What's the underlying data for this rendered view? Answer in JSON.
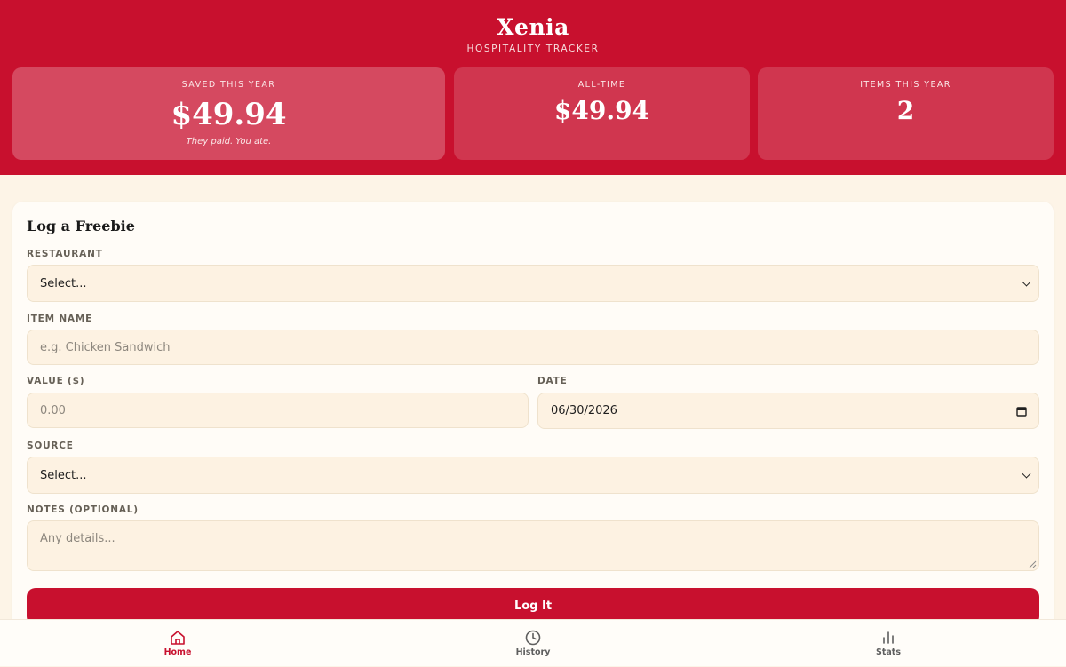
{
  "brand": {
    "title": "Xenia",
    "subtitle": "HOSPITALITY TRACKER"
  },
  "stats": {
    "saved_year": {
      "label": "SAVED THIS YEAR",
      "value": "$49.94",
      "note": "They paid. You ate."
    },
    "all_time": {
      "label": "ALL-TIME",
      "value": "$49.94"
    },
    "items_year": {
      "label": "ITEMS THIS YEAR",
      "value": "2"
    }
  },
  "form": {
    "title": "Log a Freebie",
    "restaurant": {
      "label": "RESTAURANT",
      "value": "Select..."
    },
    "item_name": {
      "label": "ITEM NAME",
      "placeholder": "e.g. Chicken Sandwich"
    },
    "value": {
      "label": "VALUE ($)",
      "placeholder": "0.00"
    },
    "date": {
      "label": "DATE",
      "value": "06/30/2026"
    },
    "source": {
      "label": "SOURCE",
      "value": "Select..."
    },
    "notes": {
      "label": "NOTES (OPTIONAL)",
      "placeholder": "Any details..."
    },
    "submit_label": "Log It"
  },
  "nav": {
    "items": [
      {
        "label": "Home",
        "icon": "home-icon",
        "active": true
      },
      {
        "label": "History",
        "icon": "clock-icon",
        "active": false
      },
      {
        "label": "Stats",
        "icon": "bar-chart-icon",
        "active": false
      }
    ]
  },
  "colors": {
    "brand": "#c8102e",
    "background": "#fdf4e7",
    "field": "#fdf2e2"
  }
}
